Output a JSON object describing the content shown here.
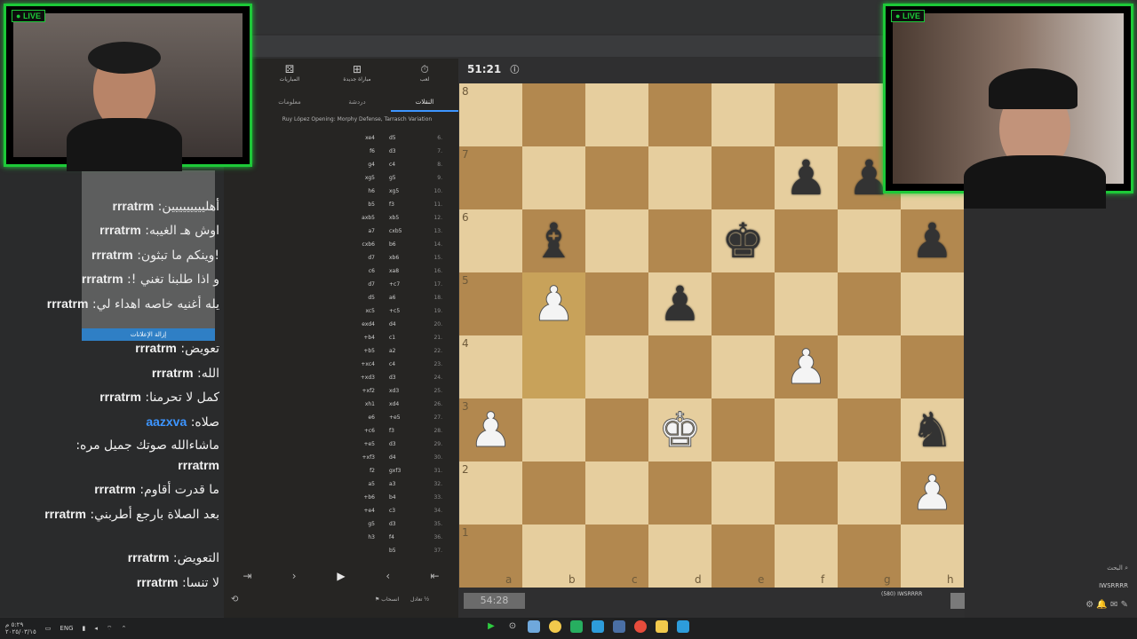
{
  "stream": {
    "live_label": "LIVE"
  },
  "panel": {
    "tabs": [
      {
        "icon": "stopwatch-icon",
        "label": "لعب"
      },
      {
        "icon": "plus-icon",
        "label": "مباراة جديدة"
      },
      {
        "icon": "dice-icon",
        "label": "المباريات"
      }
    ],
    "subtabs": [
      "النقلات",
      "دردشة",
      "معلومات"
    ],
    "opening": "Ruy López Opening: Morphy Defense, Tarrasch Variation",
    "moves": [
      {
        "n": "6.",
        "w": "d5",
        "b": "xe4"
      },
      {
        "n": "7.",
        "w": "d3",
        "b": "f6"
      },
      {
        "n": "8.",
        "w": "c4",
        "b": "g4"
      },
      {
        "n": "9.",
        "w": "g5",
        "b": "xg5"
      },
      {
        "n": "10.",
        "w": "xg5",
        "b": "h6"
      },
      {
        "n": "11.",
        "w": "f3",
        "b": "b5"
      },
      {
        "n": "12.",
        "w": "xb5",
        "b": "axb5"
      },
      {
        "n": "13.",
        "w": "cxb5",
        "b": "a7"
      },
      {
        "n": "14.",
        "w": "b6",
        "b": "cxb6"
      },
      {
        "n": "15.",
        "w": "xb6",
        "b": "d7"
      },
      {
        "n": "16.",
        "w": "xa8",
        "b": "c6"
      },
      {
        "n": "17.",
        "w": "+c7",
        "b": "d7"
      },
      {
        "n": "18.",
        "w": "a6",
        "b": "d5"
      },
      {
        "n": "19.",
        "w": "+c5",
        "b": "xc5"
      },
      {
        "n": "20.",
        "w": "d4",
        "b": "exd4"
      },
      {
        "n": "21.",
        "w": "c1",
        "b": "+b4"
      },
      {
        "n": "22.",
        "w": "a2",
        "b": "+b5"
      },
      {
        "n": "23.",
        "w": "c4",
        "b": "+xc4"
      },
      {
        "n": "24.",
        "w": "d3",
        "b": "+xd3"
      },
      {
        "n": "25.",
        "w": "xd3",
        "b": "+xf2"
      },
      {
        "n": "26.",
        "w": "xd4",
        "b": "xh1"
      },
      {
        "n": "27.",
        "w": "+e5",
        "b": "e6"
      },
      {
        "n": "28.",
        "w": "f3",
        "b": "+c6"
      },
      {
        "n": "29.",
        "w": "d3",
        "b": "+e5"
      },
      {
        "n": "30.",
        "w": "d4",
        "b": "+xf3"
      },
      {
        "n": "31.",
        "w": "gxf3",
        "b": "f2"
      },
      {
        "n": "32.",
        "w": "a3",
        "b": "a5"
      },
      {
        "n": "33.",
        "w": "b4",
        "b": "+b6"
      },
      {
        "n": "34.",
        "w": "c3",
        "b": "+e4"
      },
      {
        "n": "35.",
        "w": "d3",
        "b": "g5"
      },
      {
        "n": "36.",
        "w": "f4",
        "b": "h3"
      },
      {
        "n": "37.",
        "w": "b5",
        "b": ""
      }
    ],
    "controls": {
      "resign": "انسحاب",
      "draw": "تعادل",
      "half": "½"
    }
  },
  "timers": {
    "top": "51:21",
    "bottom": "54:28"
  },
  "board": {
    "ranks": [
      "8",
      "7",
      "6",
      "5",
      "4",
      "3",
      "2",
      "1"
    ],
    "files": [
      "a",
      "b",
      "c",
      "d",
      "e",
      "f",
      "g",
      "h"
    ],
    "pieces": [
      {
        "sq": "f7",
        "p": "♟",
        "c": "b"
      },
      {
        "sq": "g7",
        "p": "♟",
        "c": "b"
      },
      {
        "sq": "b6",
        "p": "♝",
        "c": "b"
      },
      {
        "sq": "e6",
        "p": "♚",
        "c": "b"
      },
      {
        "sq": "h6",
        "p": "♟",
        "c": "b"
      },
      {
        "sq": "b5",
        "p": "♟",
        "c": "w"
      },
      {
        "sq": "d5",
        "p": "♟",
        "c": "b"
      },
      {
        "sq": "f4",
        "p": "♟",
        "c": "w"
      },
      {
        "sq": "a3",
        "p": "♟",
        "c": "w"
      },
      {
        "sq": "d3",
        "p": "♚",
        "c": "w"
      },
      {
        "sq": "h3",
        "p": "♞",
        "c": "b"
      },
      {
        "sq": "h2",
        "p": "♟",
        "c": "w"
      }
    ],
    "highlight": [
      "b5",
      "b4"
    ]
  },
  "player": {
    "name": "IWSRRRR",
    "rating": "(580)"
  },
  "chat": {
    "overlay_button": "إزالة الإعلانات",
    "messages": [
      {
        "user": "rrratrm",
        "text": "أهلييييييييين",
        "color": "#f1f1f1"
      },
      {
        "user": "rrratrm",
        "text": "اوش هـ الغيبه",
        "color": "#f1f1f1"
      },
      {
        "user": "rrratrm",
        "text": "!وينكم ما تبثون",
        "color": "#f1f1f1"
      },
      {
        "user": "rrratrm",
        "text": "و اذا طلبنا تغني !",
        "color": "#f1f1f1"
      },
      {
        "user": "rrratrm",
        "text": "يله أغنيه خاصه اهداء لي",
        "color": "#f1f1f1"
      },
      {
        "user": "rrratrm",
        "text": "تعويض",
        "color": "#f1f1f1"
      },
      {
        "user": "rrratrm",
        "text": "الله",
        "color": "#f1f1f1"
      },
      {
        "user": "rrratrm",
        "text": "كمل لا تحرمنا",
        "color": "#f1f1f1"
      },
      {
        "user": "aazxva",
        "text": "صلاه",
        "color": "#3d95ff"
      },
      {
        "user": "rrratrm",
        "text": "ماشاءالله صوتك جميل مره",
        "color": "#f1f1f1"
      },
      {
        "user": "rrratrm",
        "text": "ما قدرت أقاوم",
        "color": "#f1f1f1"
      },
      {
        "user": "rrratrm",
        "text": "بعد الصلاة بارجع أطربني",
        "color": "#f1f1f1"
      },
      {
        "user": "rrratrm",
        "text": "التعويض",
        "color": "#f1f1f1"
      },
      {
        "user": "rrratrm",
        "text": "لا تنسا",
        "color": "#f1f1f1"
      }
    ]
  },
  "right": {
    "search_label": "البحث",
    "user": "IWSRRRR"
  },
  "taskbar": {
    "lang": "ENG",
    "time": "٥:٢٩ م",
    "date": "٢٠٢٥/٠٣/١٥"
  },
  "colors": {
    "accent_live": "#1dc938",
    "board_light": "#e6ce9e",
    "board_dark": "#b2884f"
  }
}
